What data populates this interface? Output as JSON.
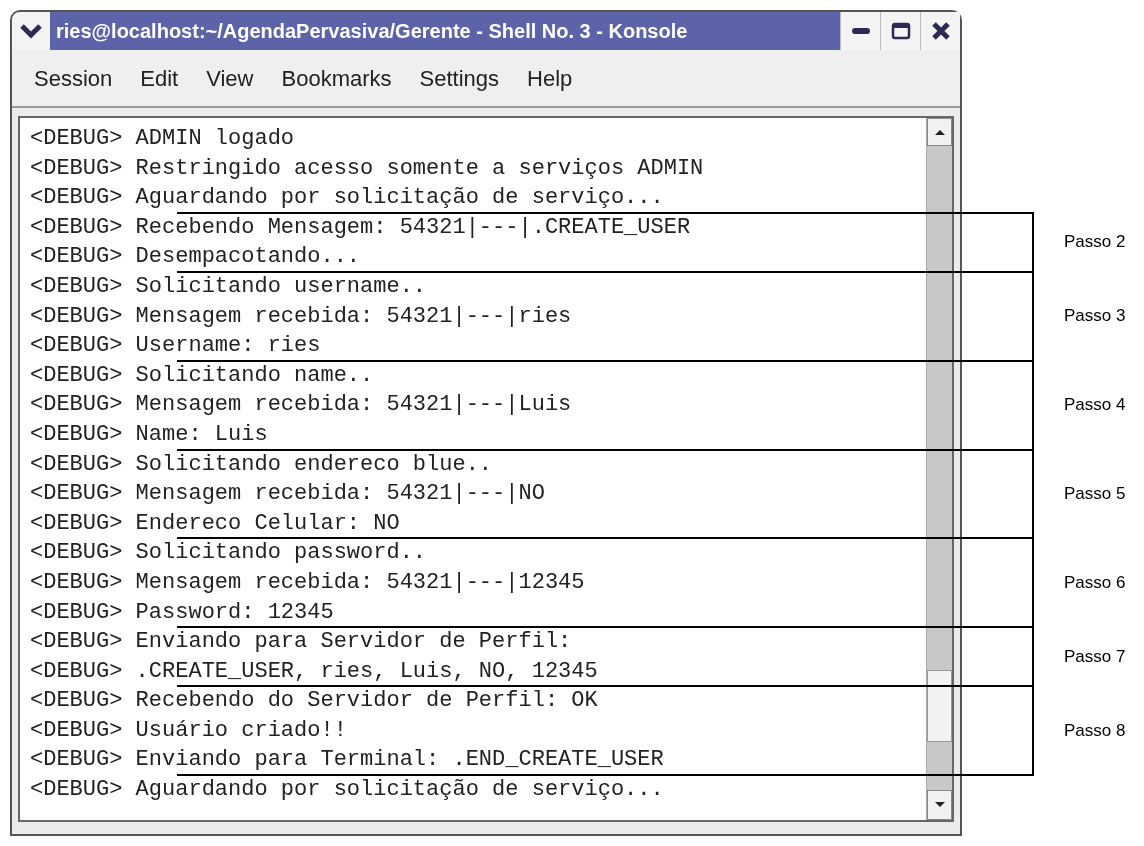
{
  "window": {
    "title": "ries@localhost:~/AgendaPervasiva/Gerente - Shell No. 3 - Konsole"
  },
  "menu": [
    "Session",
    "Edit",
    "View",
    "Bookmarks",
    "Settings",
    "Help"
  ],
  "terminal": {
    "blocks": [
      {
        "lines": [
          "<DEBUG> ADMIN logado",
          "<DEBUG> Restringido acesso somente a serviços ADMIN",
          "<DEBUG> Aguardando por solicitação de serviço..."
        ]
      },
      {
        "step": "Passo 2",
        "lines": [
          "<DEBUG> Recebendo Mensagem: 54321|---|.CREATE_USER",
          "<DEBUG> Desempacotando..."
        ]
      },
      {
        "step": "Passo 3",
        "lines": [
          "<DEBUG> Solicitando username..",
          "<DEBUG> Mensagem recebida: 54321|---|ries",
          "<DEBUG> Username: ries"
        ]
      },
      {
        "step": "Passo 4",
        "lines": [
          "<DEBUG> Solicitando name..",
          "<DEBUG> Mensagem recebida: 54321|---|Luis",
          "<DEBUG> Name: Luis"
        ]
      },
      {
        "step": "Passo 5",
        "lines": [
          "<DEBUG> Solicitando endereco blue..",
          "<DEBUG> Mensagem recebida: 54321|---|NO",
          "<DEBUG> Endereco Celular: NO"
        ]
      },
      {
        "step": "Passo 6",
        "lines": [
          "<DEBUG> Solicitando password..",
          "<DEBUG> Mensagem recebida: 54321|---|12345",
          "<DEBUG> Password: 12345"
        ]
      },
      {
        "step": "Passo 7",
        "lines": [
          "<DEBUG> Enviando para Servidor de Perfil:",
          "<DEBUG> .CREATE_USER, ries, Luis, NO, 12345"
        ]
      },
      {
        "step": "Passo 8",
        "lines": [
          "<DEBUG> Recebendo do Servidor de Perfil: OK",
          "<DEBUG> Usuário criado!!",
          "<DEBUG> Enviando para Terminal: .END_CREATE_USER"
        ]
      },
      {
        "lines": [
          "<DEBUG> Aguardando por solicitação de serviço..."
        ]
      }
    ]
  }
}
